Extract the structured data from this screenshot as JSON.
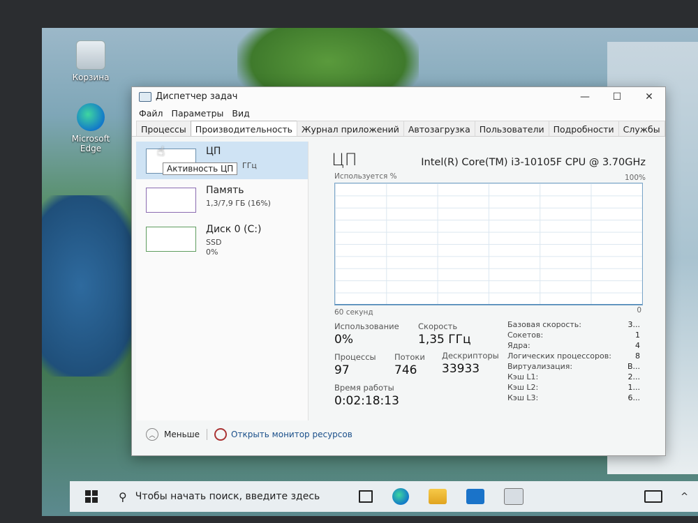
{
  "desktop": {
    "icons": [
      {
        "label": "Корзина"
      },
      {
        "label": "Microsoft Edge"
      }
    ]
  },
  "window": {
    "title": "Диспетчер задач",
    "controls": {
      "minimize": "—",
      "maximize": "☐",
      "close": "✕"
    }
  },
  "menu": [
    "Файл",
    "Параметры",
    "Вид"
  ],
  "tabs": [
    {
      "label": "Процессы"
    },
    {
      "label": "Производительность",
      "active": true
    },
    {
      "label": "Журнал приложений"
    },
    {
      "label": "Автозагрузка"
    },
    {
      "label": "Пользователи"
    },
    {
      "label": "Подробности"
    },
    {
      "label": "Службы"
    }
  ],
  "resources": {
    "cpu": {
      "name": "ЦП",
      "sub": "ГГц",
      "tooltip": "Активность ЦП"
    },
    "memory": {
      "name": "Память",
      "sub": "1,3/7,9 ГБ (16%)"
    },
    "disk": {
      "name": "Диск 0 (C:)",
      "sub1": "SSD",
      "sub2": "0%"
    }
  },
  "cpu_panel": {
    "title": "ЦП",
    "model": "Intel(R) Core(TM) i3-10105F CPU @ 3.70GHz",
    "graph": {
      "top_left": "Используется %",
      "top_right": "100%",
      "bottom_left": "60 секунд",
      "bottom_right": "0"
    },
    "stats": {
      "usage_label": "Использование",
      "usage_value": "0%",
      "speed_label": "Скорость",
      "speed_value": "1,35 ГГц",
      "processes_label": "Процессы",
      "processes_value": "97",
      "threads_label": "Потоки",
      "threads_value": "746",
      "handles_label": "Дескрипторы",
      "handles_value": "33933",
      "uptime_label": "Время работы",
      "uptime_value": "0:02:18:13"
    },
    "specs": [
      {
        "label": "Базовая скорость:",
        "value": "3..."
      },
      {
        "label": "Сокетов:",
        "value": "1"
      },
      {
        "label": "Ядра:",
        "value": "4"
      },
      {
        "label": "Логических процессоров:",
        "value": "8"
      },
      {
        "label": "Виртуализация:",
        "value": "В..."
      },
      {
        "label": "Кэш L1:",
        "value": "2..."
      },
      {
        "label": "Кэш L2:",
        "value": "1..."
      },
      {
        "label": "Кэш L3:",
        "value": "6..."
      }
    ]
  },
  "footer": {
    "less": "Меньше",
    "resource_monitor": "Открыть монитор ресурсов"
  },
  "taskbar": {
    "search_placeholder": "Чтобы начать поиск, введите здесь"
  }
}
